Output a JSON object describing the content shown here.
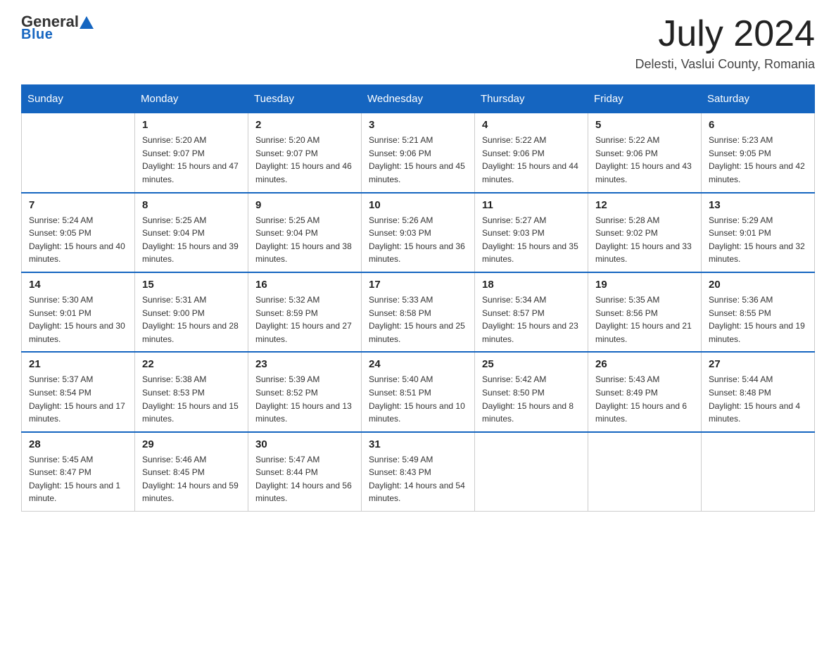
{
  "logo": {
    "general": "General",
    "blue": "Blue",
    "underline": "Blue"
  },
  "title": {
    "month": "July 2024",
    "location": "Delesti, Vaslui County, Romania"
  },
  "weekdays": [
    "Sunday",
    "Monday",
    "Tuesday",
    "Wednesday",
    "Thursday",
    "Friday",
    "Saturday"
  ],
  "weeks": [
    [
      {
        "day": "",
        "sunrise": "",
        "sunset": "",
        "daylight": ""
      },
      {
        "day": "1",
        "sunrise": "Sunrise: 5:20 AM",
        "sunset": "Sunset: 9:07 PM",
        "daylight": "Daylight: 15 hours and 47 minutes."
      },
      {
        "day": "2",
        "sunrise": "Sunrise: 5:20 AM",
        "sunset": "Sunset: 9:07 PM",
        "daylight": "Daylight: 15 hours and 46 minutes."
      },
      {
        "day": "3",
        "sunrise": "Sunrise: 5:21 AM",
        "sunset": "Sunset: 9:06 PM",
        "daylight": "Daylight: 15 hours and 45 minutes."
      },
      {
        "day": "4",
        "sunrise": "Sunrise: 5:22 AM",
        "sunset": "Sunset: 9:06 PM",
        "daylight": "Daylight: 15 hours and 44 minutes."
      },
      {
        "day": "5",
        "sunrise": "Sunrise: 5:22 AM",
        "sunset": "Sunset: 9:06 PM",
        "daylight": "Daylight: 15 hours and 43 minutes."
      },
      {
        "day": "6",
        "sunrise": "Sunrise: 5:23 AM",
        "sunset": "Sunset: 9:05 PM",
        "daylight": "Daylight: 15 hours and 42 minutes."
      }
    ],
    [
      {
        "day": "7",
        "sunrise": "Sunrise: 5:24 AM",
        "sunset": "Sunset: 9:05 PM",
        "daylight": "Daylight: 15 hours and 40 minutes."
      },
      {
        "day": "8",
        "sunrise": "Sunrise: 5:25 AM",
        "sunset": "Sunset: 9:04 PM",
        "daylight": "Daylight: 15 hours and 39 minutes."
      },
      {
        "day": "9",
        "sunrise": "Sunrise: 5:25 AM",
        "sunset": "Sunset: 9:04 PM",
        "daylight": "Daylight: 15 hours and 38 minutes."
      },
      {
        "day": "10",
        "sunrise": "Sunrise: 5:26 AM",
        "sunset": "Sunset: 9:03 PM",
        "daylight": "Daylight: 15 hours and 36 minutes."
      },
      {
        "day": "11",
        "sunrise": "Sunrise: 5:27 AM",
        "sunset": "Sunset: 9:03 PM",
        "daylight": "Daylight: 15 hours and 35 minutes."
      },
      {
        "day": "12",
        "sunrise": "Sunrise: 5:28 AM",
        "sunset": "Sunset: 9:02 PM",
        "daylight": "Daylight: 15 hours and 33 minutes."
      },
      {
        "day": "13",
        "sunrise": "Sunrise: 5:29 AM",
        "sunset": "Sunset: 9:01 PM",
        "daylight": "Daylight: 15 hours and 32 minutes."
      }
    ],
    [
      {
        "day": "14",
        "sunrise": "Sunrise: 5:30 AM",
        "sunset": "Sunset: 9:01 PM",
        "daylight": "Daylight: 15 hours and 30 minutes."
      },
      {
        "day": "15",
        "sunrise": "Sunrise: 5:31 AM",
        "sunset": "Sunset: 9:00 PM",
        "daylight": "Daylight: 15 hours and 28 minutes."
      },
      {
        "day": "16",
        "sunrise": "Sunrise: 5:32 AM",
        "sunset": "Sunset: 8:59 PM",
        "daylight": "Daylight: 15 hours and 27 minutes."
      },
      {
        "day": "17",
        "sunrise": "Sunrise: 5:33 AM",
        "sunset": "Sunset: 8:58 PM",
        "daylight": "Daylight: 15 hours and 25 minutes."
      },
      {
        "day": "18",
        "sunrise": "Sunrise: 5:34 AM",
        "sunset": "Sunset: 8:57 PM",
        "daylight": "Daylight: 15 hours and 23 minutes."
      },
      {
        "day": "19",
        "sunrise": "Sunrise: 5:35 AM",
        "sunset": "Sunset: 8:56 PM",
        "daylight": "Daylight: 15 hours and 21 minutes."
      },
      {
        "day": "20",
        "sunrise": "Sunrise: 5:36 AM",
        "sunset": "Sunset: 8:55 PM",
        "daylight": "Daylight: 15 hours and 19 minutes."
      }
    ],
    [
      {
        "day": "21",
        "sunrise": "Sunrise: 5:37 AM",
        "sunset": "Sunset: 8:54 PM",
        "daylight": "Daylight: 15 hours and 17 minutes."
      },
      {
        "day": "22",
        "sunrise": "Sunrise: 5:38 AM",
        "sunset": "Sunset: 8:53 PM",
        "daylight": "Daylight: 15 hours and 15 minutes."
      },
      {
        "day": "23",
        "sunrise": "Sunrise: 5:39 AM",
        "sunset": "Sunset: 8:52 PM",
        "daylight": "Daylight: 15 hours and 13 minutes."
      },
      {
        "day": "24",
        "sunrise": "Sunrise: 5:40 AM",
        "sunset": "Sunset: 8:51 PM",
        "daylight": "Daylight: 15 hours and 10 minutes."
      },
      {
        "day": "25",
        "sunrise": "Sunrise: 5:42 AM",
        "sunset": "Sunset: 8:50 PM",
        "daylight": "Daylight: 15 hours and 8 minutes."
      },
      {
        "day": "26",
        "sunrise": "Sunrise: 5:43 AM",
        "sunset": "Sunset: 8:49 PM",
        "daylight": "Daylight: 15 hours and 6 minutes."
      },
      {
        "day": "27",
        "sunrise": "Sunrise: 5:44 AM",
        "sunset": "Sunset: 8:48 PM",
        "daylight": "Daylight: 15 hours and 4 minutes."
      }
    ],
    [
      {
        "day": "28",
        "sunrise": "Sunrise: 5:45 AM",
        "sunset": "Sunset: 8:47 PM",
        "daylight": "Daylight: 15 hours and 1 minute."
      },
      {
        "day": "29",
        "sunrise": "Sunrise: 5:46 AM",
        "sunset": "Sunset: 8:45 PM",
        "daylight": "Daylight: 14 hours and 59 minutes."
      },
      {
        "day": "30",
        "sunrise": "Sunrise: 5:47 AM",
        "sunset": "Sunset: 8:44 PM",
        "daylight": "Daylight: 14 hours and 56 minutes."
      },
      {
        "day": "31",
        "sunrise": "Sunrise: 5:49 AM",
        "sunset": "Sunset: 8:43 PM",
        "daylight": "Daylight: 14 hours and 54 minutes."
      },
      {
        "day": "",
        "sunrise": "",
        "sunset": "",
        "daylight": ""
      },
      {
        "day": "",
        "sunrise": "",
        "sunset": "",
        "daylight": ""
      },
      {
        "day": "",
        "sunrise": "",
        "sunset": "",
        "daylight": ""
      }
    ]
  ]
}
